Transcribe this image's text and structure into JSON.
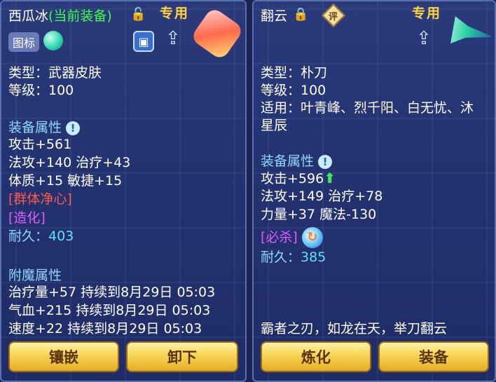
{
  "left": {
    "name": "西瓜冰",
    "equipped_tag": "(当前装备)",
    "special_label": "专用",
    "icon_badge": "图标",
    "type_line": "类型：武器皮肤",
    "level_line": "等级：100",
    "attr_title": "装备属性",
    "attrs": [
      "攻击+561",
      "法攻+140 治疗+43",
      "体质+15 敏捷+15"
    ],
    "skill_1": "[群体净心]",
    "skill_2": "[造化]",
    "durability_label": "耐久：",
    "durability_value": "403",
    "enchant_title": "附魔属性",
    "enchants": [
      "治疗量+57 持续到8月29日 05:03",
      "气血+215 持续到8月29日 05:03",
      "速度+22 持续到8月29日 05:03"
    ],
    "btn_inlay": "镶嵌",
    "btn_unload": "卸下"
  },
  "right": {
    "name": "翻云",
    "review_badge": "评",
    "special_label": "专用",
    "type_line": "类型：朴刀",
    "level_line": "等级：100",
    "applicable_line1": "适用：叶青峰、烈千阳、白无忧、沐",
    "applicable_line2": "星辰",
    "attr_title": "装备属性",
    "attr_1": "攻击+596",
    "attrs_rest": [
      "法攻+149 治疗+78",
      "力量+37 魔法-130"
    ],
    "skill": "[必杀]",
    "durability_label": "耐久：",
    "durability_value": "385",
    "flavor": "霸者之刃，如龙在天，举刀翻云",
    "btn_refine": "炼化",
    "btn_equip": "装备"
  },
  "icons": [
    "lock-open-icon",
    "lock-icon",
    "info-icon",
    "share-icon",
    "preview-icon",
    "arrow-up-icon",
    "orb-icon"
  ]
}
